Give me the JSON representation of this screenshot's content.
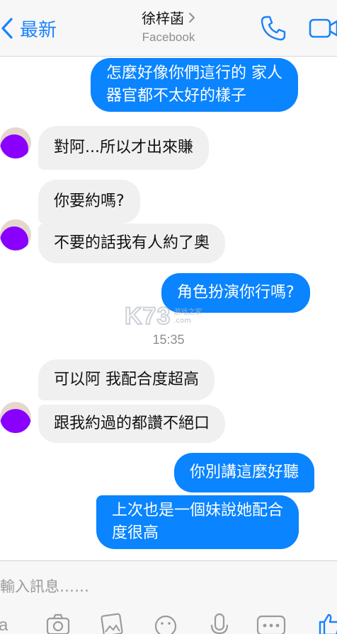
{
  "header": {
    "back_label": "最新",
    "contact_name": "徐梓菡",
    "subtitle": "Facebook"
  },
  "messages": [
    {
      "direction": "out",
      "text_lines": [
        "怎麼好像你們這行的 家人",
        "器官都不太好的樣子"
      ]
    },
    {
      "direction": "in",
      "text": "對阿...所以才出來賺"
    },
    {
      "direction": "in",
      "text": "你要約嗎?"
    },
    {
      "direction": "in",
      "text": "不要的話我有人約了奧"
    },
    {
      "direction": "out",
      "text": "角色扮演你行嗎?"
    },
    {
      "direction": "in",
      "text": "可以阿 我配合度超高"
    },
    {
      "direction": "in",
      "text": "跟我約過的都讚不絕口"
    },
    {
      "direction": "out",
      "text": "你別講這麼好聽"
    },
    {
      "direction": "out",
      "text_lines": [
        "上次也是一個妹說她配合",
        "度很高"
      ]
    }
  ],
  "timestamp": "15:35",
  "watermark": {
    "logo": "K73",
    "line1": "游戏之家",
    "line2": ".com"
  },
  "input": {
    "placeholder": "輸入訊息……"
  },
  "toolbar_icons": [
    "text-icon",
    "camera-icon",
    "photo-icon",
    "sticker-icon",
    "microphone-icon",
    "more-icon",
    "like-icon"
  ],
  "colors": {
    "accent": "#0a84ff",
    "header_blue": "#1a82fb",
    "incoming_bubble": "#f0f0f0",
    "avatar_mask": "#8a00ff"
  }
}
